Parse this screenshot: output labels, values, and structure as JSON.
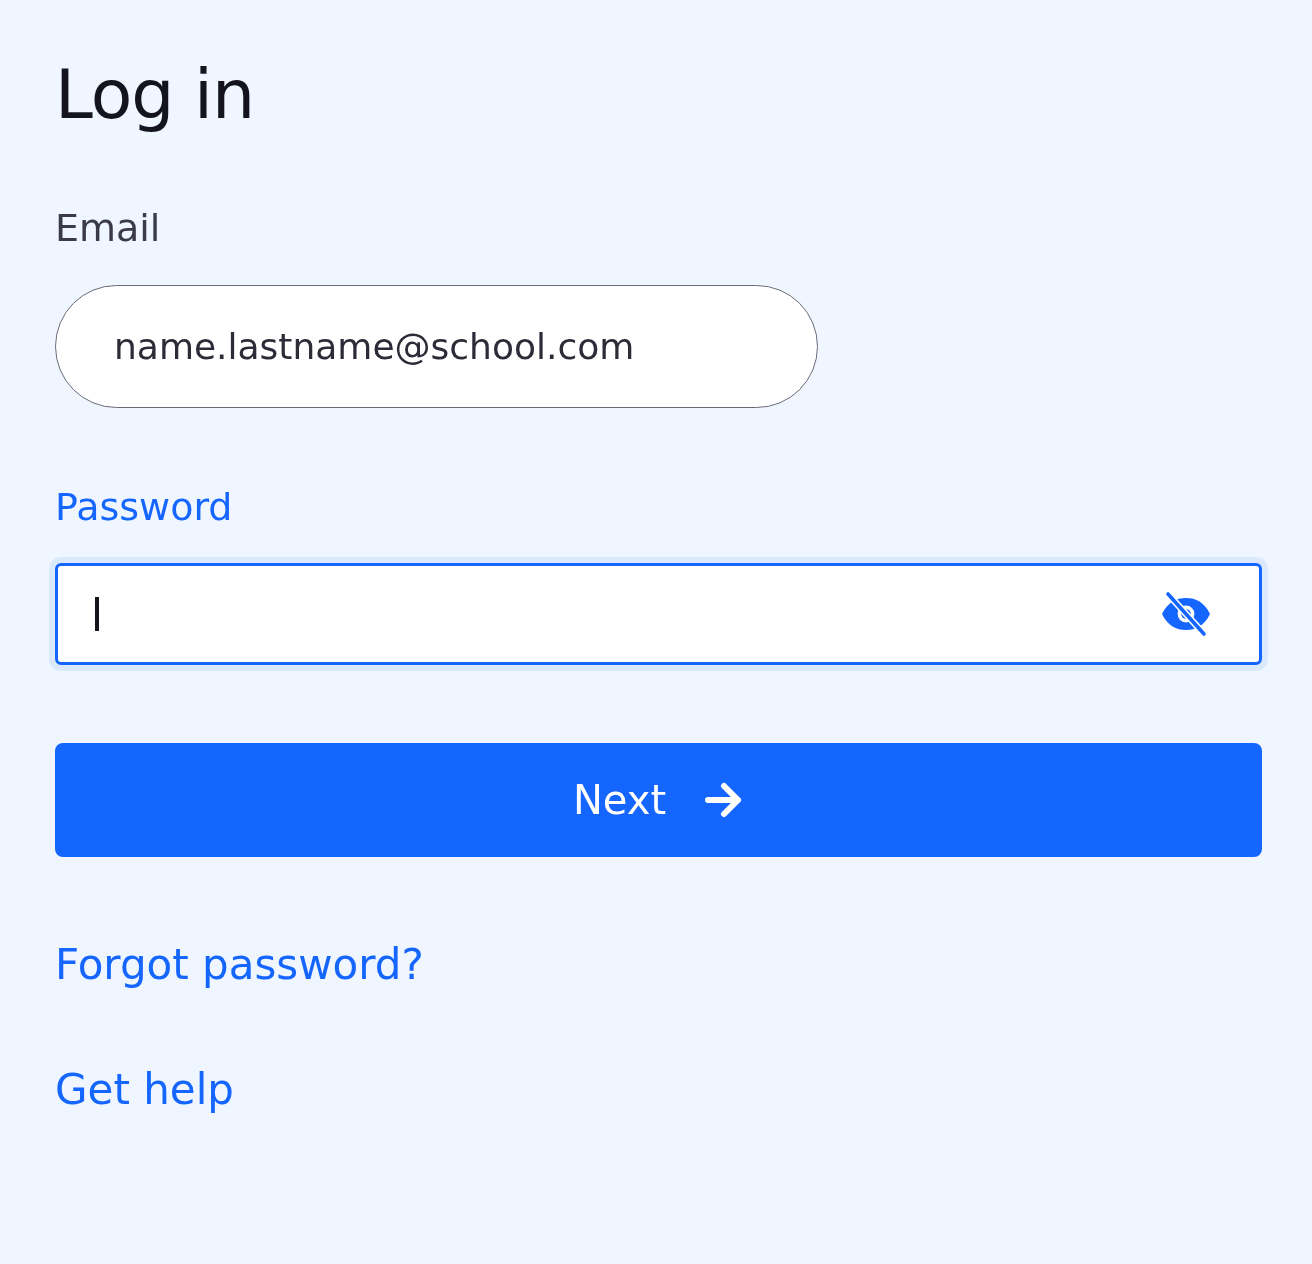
{
  "title": "Log in",
  "fields": [
    {
      "label": "Email",
      "value": "name.lastname@school.com",
      "focused": false,
      "kind": "email"
    },
    {
      "label": "Password",
      "focused": true,
      "kind": "password"
    }
  ],
  "button": {
    "label": "Next"
  },
  "links": [
    "Forgot password?",
    "Get help"
  ]
}
